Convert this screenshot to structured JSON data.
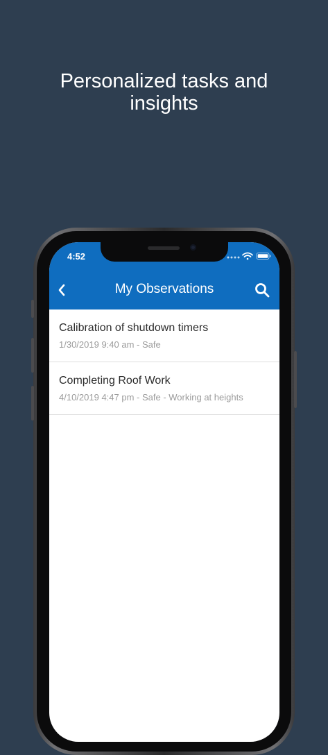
{
  "headline": {
    "line1": "Personalized tasks and",
    "line2": "insights"
  },
  "status_bar": {
    "time": "4:52",
    "icons": [
      "signal-dots-icon",
      "wifi-icon",
      "battery-icon"
    ]
  },
  "nav_bar": {
    "title": "My Observations",
    "back_icon": "chevron-left-icon",
    "search_icon": "search-icon"
  },
  "observations": [
    {
      "title": "Calibration of shutdown timers",
      "subtitle": "1/30/2019 9:40 am - Safe"
    },
    {
      "title": "Completing Roof Work",
      "subtitle": "4/10/2019 4:47 pm - Safe - Working at heights"
    }
  ],
  "colors": {
    "background": "#2e3e50",
    "header": "#0f6dbf",
    "row_title": "#2b2b2b",
    "row_subtitle": "#9b9b9b"
  }
}
